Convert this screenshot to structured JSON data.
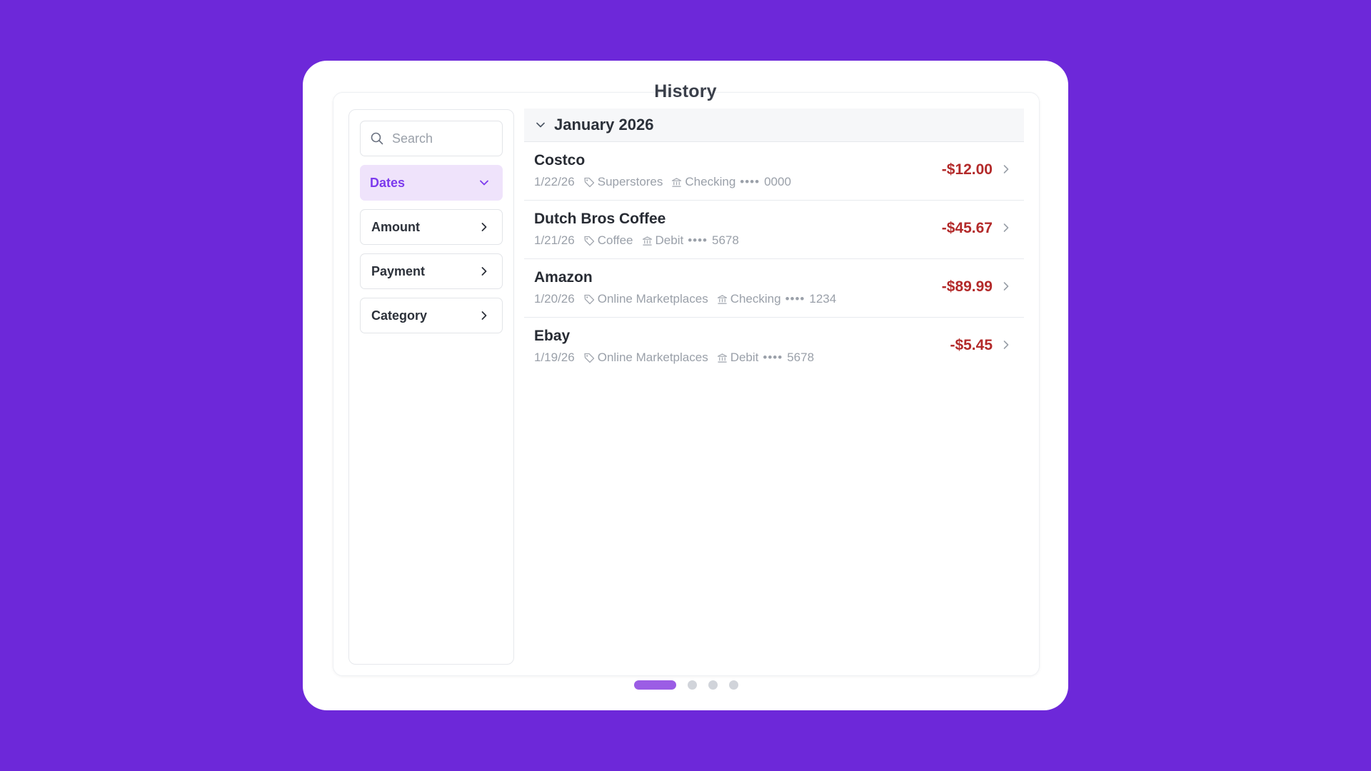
{
  "header": {
    "title": "History"
  },
  "sidebar": {
    "search": {
      "placeholder": "Search",
      "value": ""
    },
    "filters": [
      {
        "label": "Dates",
        "state": "expanded"
      },
      {
        "label": "Amount",
        "state": "collapsed"
      },
      {
        "label": "Payment",
        "state": "collapsed"
      },
      {
        "label": "Category",
        "state": "collapsed"
      }
    ]
  },
  "main": {
    "group": {
      "label": "January 2026",
      "transactions": [
        {
          "merchant": "Costco",
          "date": "1/22/26",
          "category": "Superstores",
          "account": "Checking",
          "mask": "••••",
          "last4": "0000",
          "amount": "-$12.00"
        },
        {
          "merchant": "Dutch Bros Coffee",
          "date": "1/21/26",
          "category": "Coffee",
          "account": "Debit",
          "mask": "••••",
          "last4": "5678",
          "amount": "-$45.67"
        },
        {
          "merchant": "Amazon",
          "date": "1/20/26",
          "category": "Online Marketplaces",
          "account": "Checking",
          "mask": "••••",
          "last4": "1234",
          "amount": "-$89.99"
        },
        {
          "merchant": "Ebay",
          "date": "1/19/26",
          "category": "Online Marketplaces",
          "account": "Debit",
          "mask": "••••",
          "last4": "5678",
          "amount": "-$5.45"
        }
      ]
    }
  },
  "pagination": {
    "pages": 4,
    "current": 1
  },
  "colors": {
    "background": "#6d28d9",
    "accent": "#7c3aed",
    "active_filter_bg": "#efe3fb",
    "negative_amount": "#b32a2a",
    "muted_text": "#9aa0a9"
  }
}
